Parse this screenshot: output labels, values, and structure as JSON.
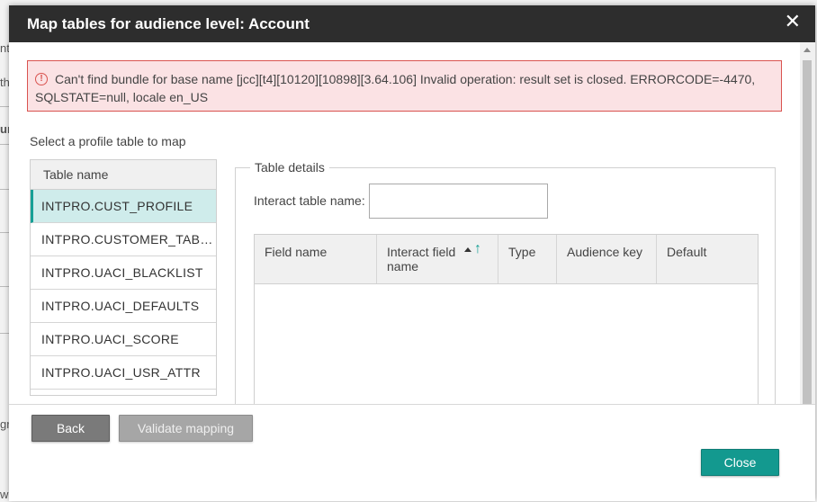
{
  "background": {
    "fragments": [
      "nt",
      "th",
      "ur",
      "gr",
      "w"
    ]
  },
  "dialog": {
    "title": "Map tables for audience level: Account",
    "close_glyph": "✕"
  },
  "error": {
    "icon": "!",
    "message": "Can't find bundle for base name [jcc][t4][10120][10898][3.64.106] Invalid operation: result set is closed. ERRORCODE=-4470, SQLSTATE=null, locale en_US"
  },
  "profile": {
    "label": "Select a profile table to map",
    "header": "Table name",
    "items": [
      {
        "label": "INTPRO.CUST_PROFILE",
        "selected": true
      },
      {
        "label": "INTPRO.CUSTOMER_TABLE",
        "selected": false
      },
      {
        "label": "INTPRO.UACI_BLACKLIST",
        "selected": false
      },
      {
        "label": "INTPRO.UACI_DEFAULTS",
        "selected": false
      },
      {
        "label": "INTPRO.UACI_SCORE",
        "selected": false
      },
      {
        "label": "INTPRO.UACI_USR_ATTR",
        "selected": false
      }
    ]
  },
  "details": {
    "legend": "Table details",
    "interact_label": "Interact table name:",
    "interact_value": "",
    "columns": [
      "Field name",
      "Interact field name",
      "Type",
      "Audience key",
      "Default"
    ]
  },
  "footer": {
    "back": "Back",
    "validate": "Validate mapping",
    "close": "Close"
  },
  "colors": {
    "accent": "#13998f",
    "error_border": "#d9534f",
    "error_bg": "#fbe2e4",
    "titlebar": "#2d2d2d"
  }
}
